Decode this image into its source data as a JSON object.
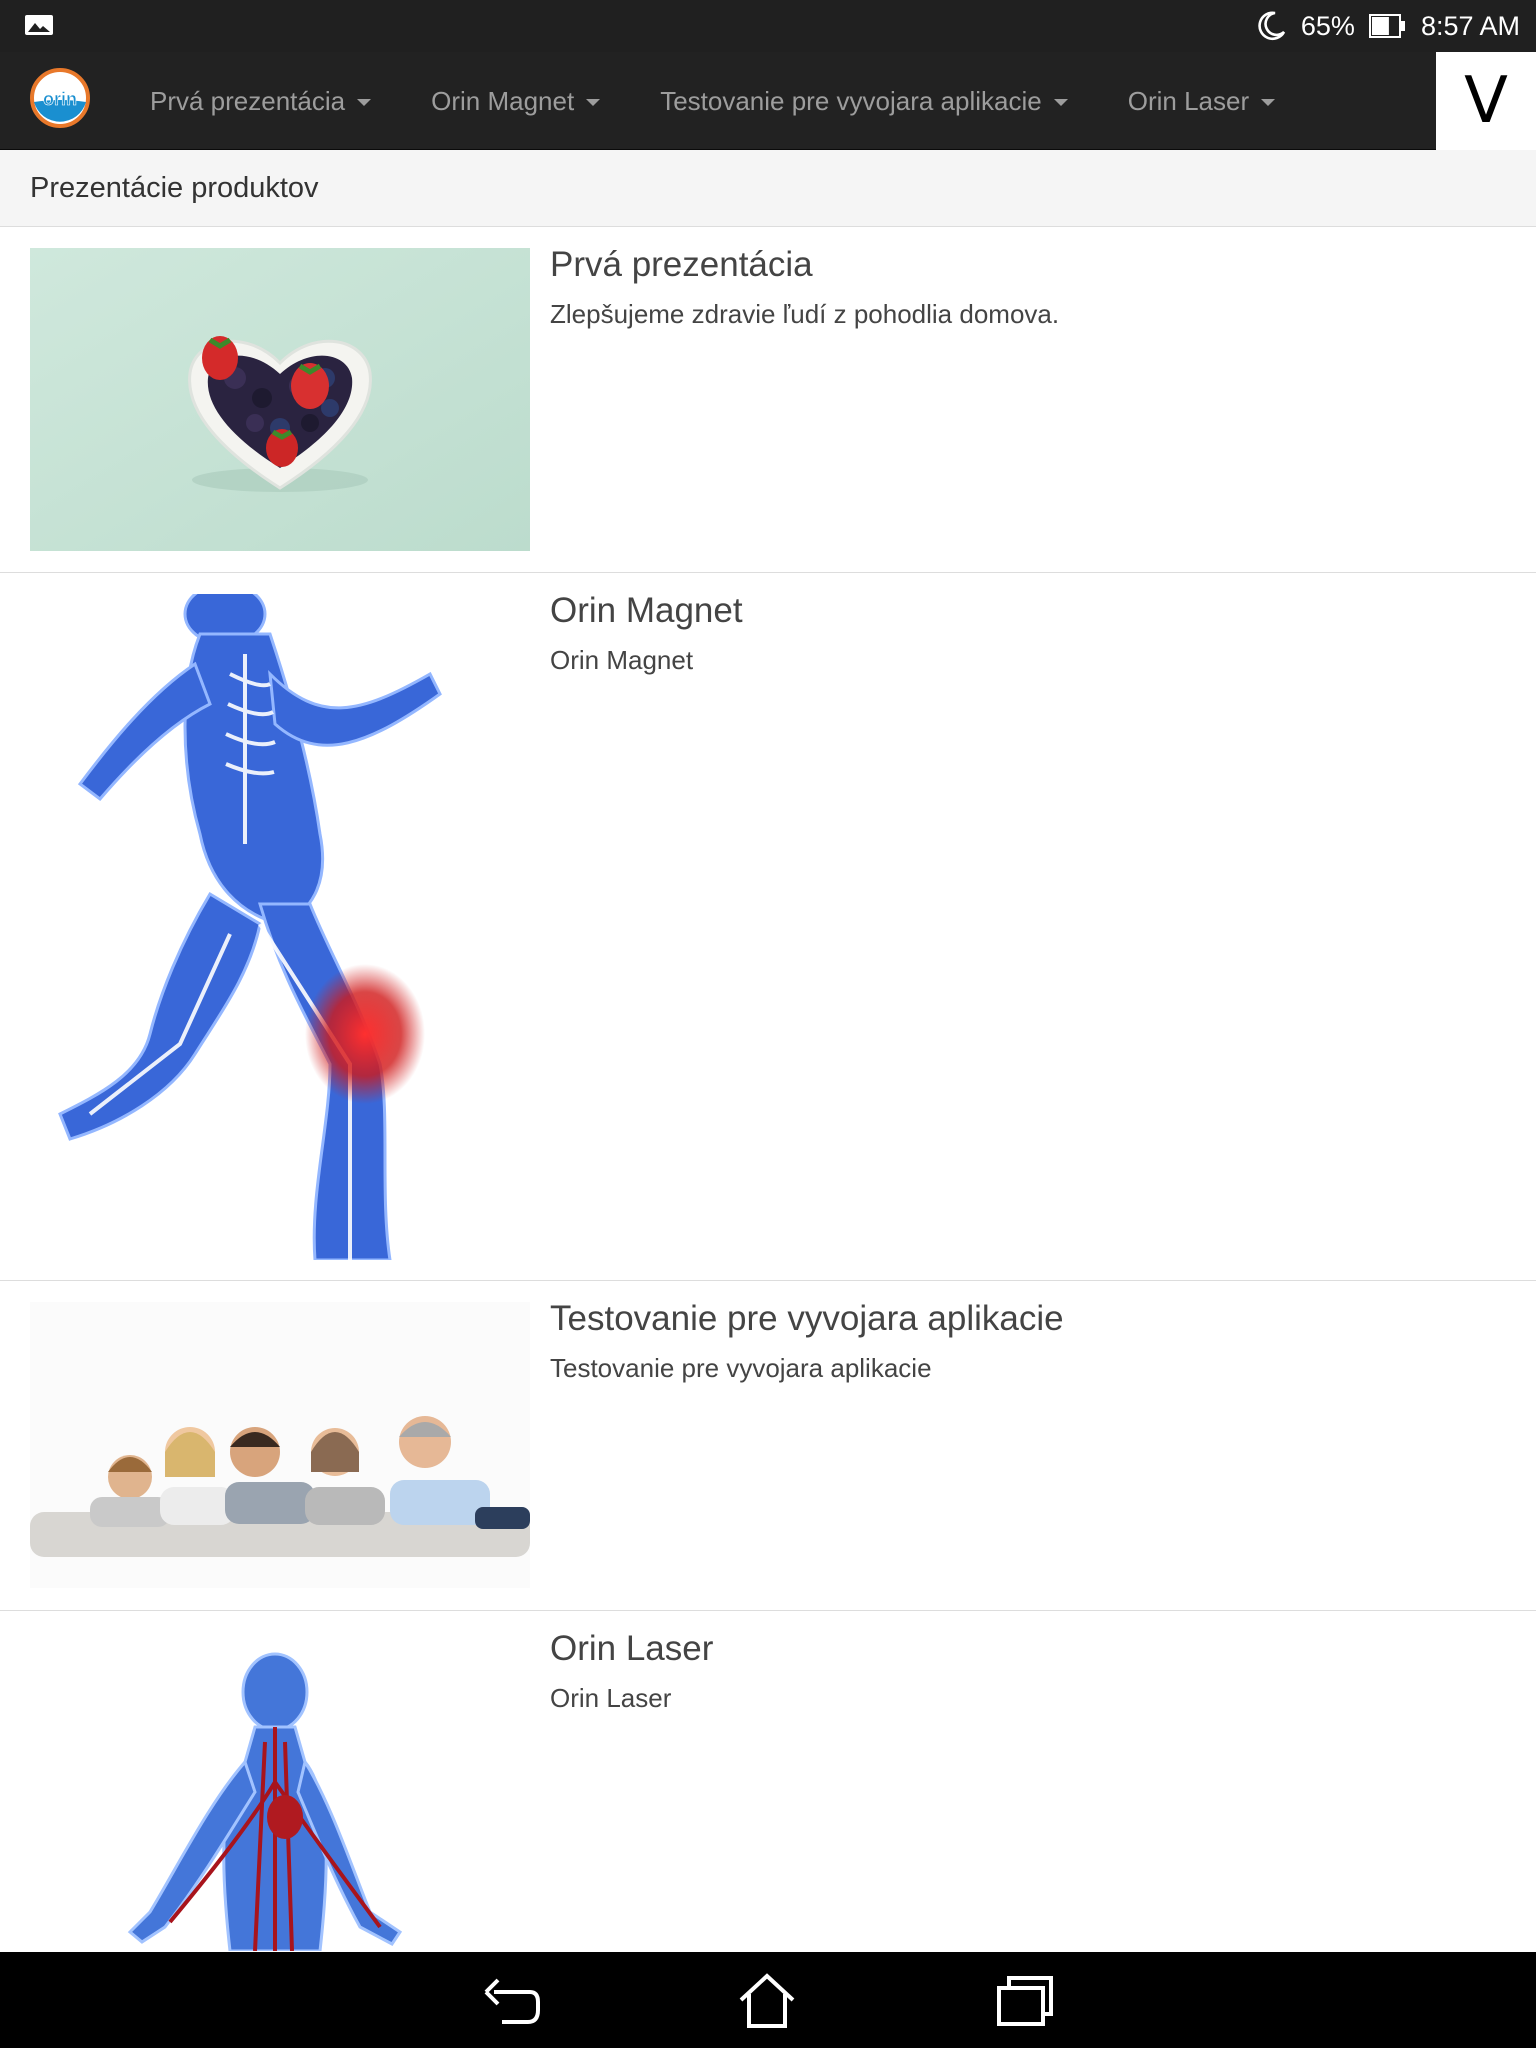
{
  "status_bar": {
    "notification_icon": "image-icon",
    "dnd_icon": "moon-icon",
    "battery_percent": "65%",
    "battery_level": 0.65,
    "time": "8:57 AM"
  },
  "navbar": {
    "brand_text": "orin",
    "items": [
      {
        "label": "Prvá prezentácia"
      },
      {
        "label": "Orin Magnet"
      },
      {
        "label": "Testovanie pre vyvojara aplikacie"
      },
      {
        "label": "Orin Laser"
      }
    ],
    "user_initial": "V"
  },
  "breadcrumb": {
    "title": "Prezentácie produktov"
  },
  "products": [
    {
      "title": "Prvá prezentácia",
      "description": "Zlepšujeme zdravie ľudí z pohodlia domova.",
      "image": "heart-bowl-berries"
    },
    {
      "title": "Orin Magnet",
      "description": "Orin Magnet",
      "image": "running-skeleton-xray"
    },
    {
      "title": "Testovanie pre vyvojara aplikacie",
      "description": "Testovanie pre vyvojara aplikacie",
      "image": "family-lying-on-floor"
    },
    {
      "title": "Orin Laser",
      "description": "Orin Laser",
      "image": "circulatory-system-body"
    }
  ],
  "system_nav": {
    "back": "back-icon",
    "home": "home-icon",
    "recents": "recents-icon"
  },
  "colors": {
    "statusbar_bg": "#202020",
    "navbar_bg": "#222222",
    "nav_text": "#9d9d9d",
    "breadcrumb_bg": "#f5f5f5",
    "divider": "#dddddd",
    "brand_orange": "#e8782a",
    "brand_blue": "#1a8fd0"
  }
}
